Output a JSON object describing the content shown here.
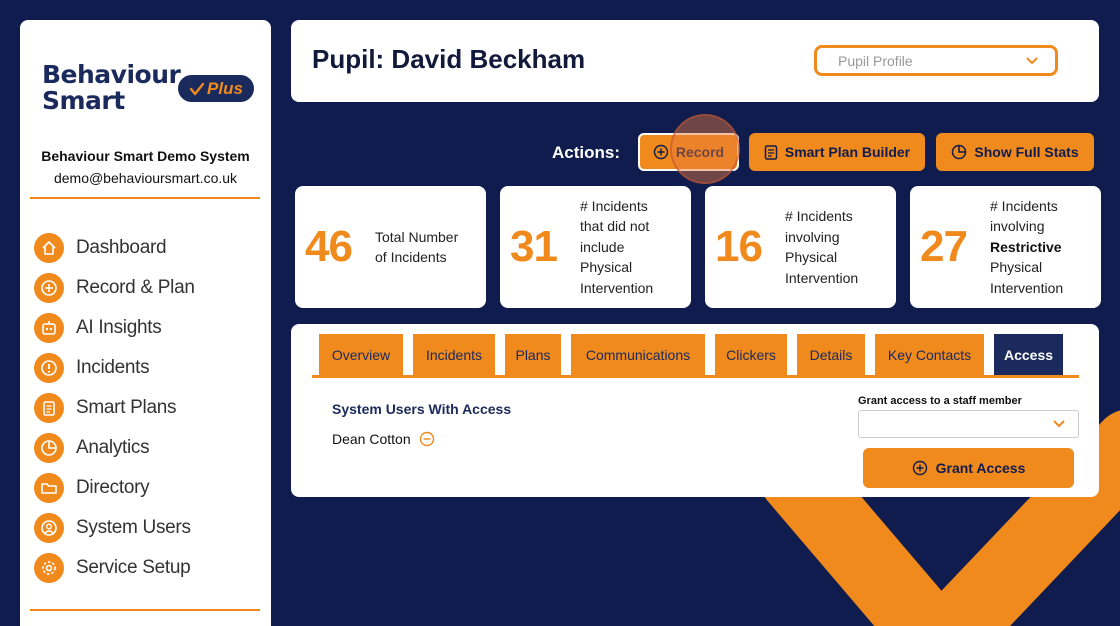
{
  "colors": {
    "navy": "#0f1c4d",
    "orange": "#f08a1c",
    "white": "#ffffff"
  },
  "brand": {
    "line1": "Behaviour",
    "line2": "Smart",
    "badge": "Plus"
  },
  "org": {
    "name": "Behaviour Smart Demo System",
    "email": "demo@behavioursmart.co.uk"
  },
  "nav": [
    {
      "label": "Dashboard",
      "icon": "home-icon"
    },
    {
      "label": "Record & Plan",
      "icon": "plus-circle-icon"
    },
    {
      "label": "AI Insights",
      "icon": "robot-icon"
    },
    {
      "label": "Incidents",
      "icon": "alert-icon"
    },
    {
      "label": "Smart Plans",
      "icon": "clipboard-icon"
    },
    {
      "label": "Analytics",
      "icon": "pie-chart-icon"
    },
    {
      "label": "Directory",
      "icon": "folder-icon"
    },
    {
      "label": "System Users",
      "icon": "user-icon"
    },
    {
      "label": "Service Setup",
      "icon": "gear-icon"
    }
  ],
  "header": {
    "title": "Pupil: David Beckham",
    "profile_select": "Pupil Profile"
  },
  "actions": {
    "label": "Actions:",
    "record": "Record",
    "plan_builder": "Smart Plan Builder",
    "full_stats": "Show Full Stats"
  },
  "stats": [
    {
      "value": "46",
      "desc_lines": [
        "Total Number",
        "of Incidents"
      ]
    },
    {
      "value": "31",
      "desc_lines": [
        "# Incidents",
        "that did not",
        "include",
        "Physical",
        "Intervention"
      ]
    },
    {
      "value": "16",
      "desc_lines": [
        "# Incidents",
        "involving",
        "Physical",
        "Intervention"
      ]
    },
    {
      "value": "27",
      "desc_lines": [
        "# Incidents",
        "involving",
        "Restrictive",
        "Physical",
        "Intervention"
      ]
    }
  ],
  "tabs": [
    "Overview",
    "Incidents",
    "Plans",
    "Communications",
    "Clickers",
    "Details",
    "Key Contacts",
    "Access"
  ],
  "active_tab": "Access",
  "access": {
    "title": "System Users With Access",
    "users": [
      "Dean Cotton"
    ],
    "grant_label": "Grant access to a staff member",
    "grant_select_value": "",
    "grant_button": "Grant Access"
  }
}
